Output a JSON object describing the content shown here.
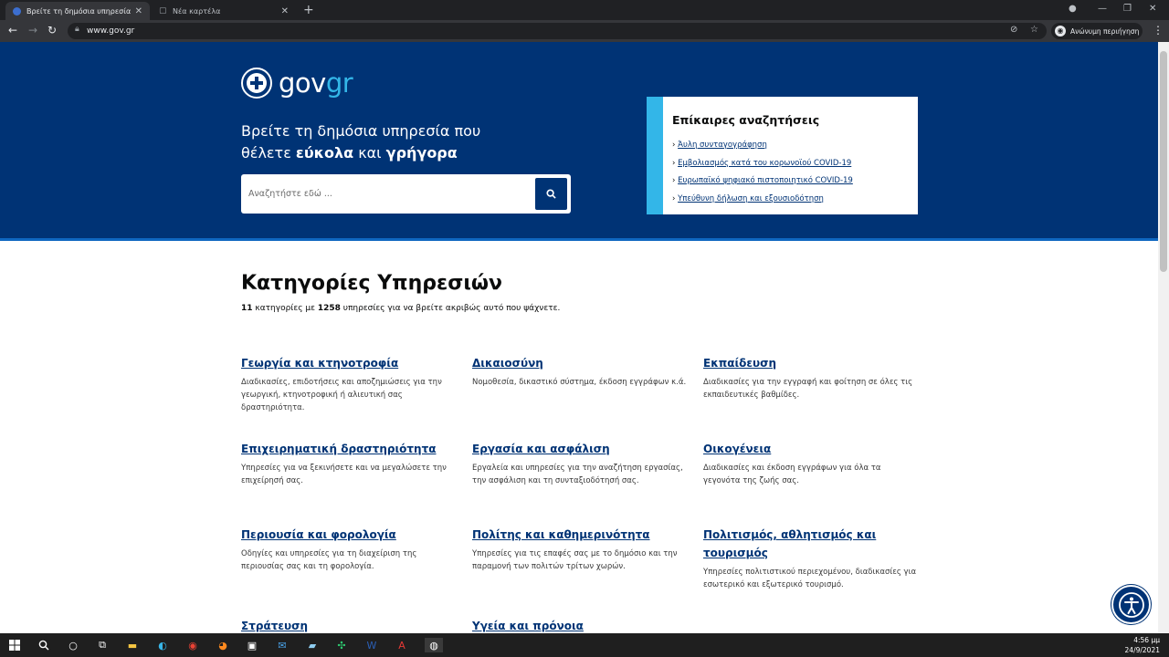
{
  "browser": {
    "tabs": [
      {
        "label": "Βρείτε τη δημόσια υπηρεσία που"
      },
      {
        "label": "Νέα καρτέλα"
      }
    ],
    "url": "www.gov.gr",
    "incognito_label": "Ανώνυμη περιήγηση"
  },
  "hero": {
    "brand_prefix": "gov",
    "brand_suffix": "gr",
    "tagline_line1": "Βρείτε τη δημόσια υπηρεσία που",
    "tagline_pre": "θέλετε ",
    "tagline_bold1": "εύκολα",
    "tagline_mid": " και ",
    "tagline_bold2": "γρήγορα",
    "search_placeholder": "Αναζητήστε εδώ ..."
  },
  "trending": {
    "title": "Επίκαιρες αναζητήσεις",
    "items": [
      "Άυλη συνταγογράφηση",
      "Εμβολιασμός κατά του κορωνοϊού COVID-19",
      "Ευρωπαϊκό ψηφιακό πιστοποιητικό COVID-19",
      "Υπεύθυνη δήλωση και εξουσιοδότηση"
    ]
  },
  "categories_section": {
    "title": "Κατηγορίες Υπηρεσιών",
    "count": "11",
    "text1": " κατηγορίες με ",
    "services": "1258",
    "text2": " υπηρεσίες για να βρείτε ακριβώς αυτό που ψάχνετε."
  },
  "categories": [
    {
      "title": "Γεωργία και κτηνοτροφία",
      "desc": "Διαδικασίες, επιδοτήσεις και αποζημιώσεις για την γεωργική, κτηνοτροφική ή αλιευτική σας δραστηριότητα."
    },
    {
      "title": "Δικαιοσύνη",
      "desc": "Νομοθεσία, δικαστικό σύστημα, έκδοση εγγράφων κ.ά."
    },
    {
      "title": "Εκπαίδευση",
      "desc": "Διαδικασίες για την εγγραφή και φοίτηση σε όλες τις εκπαιδευτικές βαθμίδες."
    },
    {
      "title": "Επιχειρηματική δραστηριότητα",
      "desc": "Υπηρεσίες για να ξεκινήσετε και να μεγαλώσετε την επιχείρησή σας."
    },
    {
      "title": "Εργασία και ασφάλιση",
      "desc": "Εργαλεία και υπηρεσίες για την αναζήτηση εργασίας, την ασφάλιση και τη συνταξιοδότησή σας."
    },
    {
      "title": "Οικογένεια",
      "desc": "Διαδικασίες και έκδοση εγγράφων για όλα τα γεγονότα της ζωής σας."
    },
    {
      "title": "Περιουσία και φορολογία",
      "desc": "Οδηγίες και υπηρεσίες για τη διαχείριση της περιουσίας σας και τη φορολογία."
    },
    {
      "title": "Πολίτης και καθημερινότητα",
      "desc": "Υπηρεσίες για τις επαφές σας με το δημόσιο και την παραμονή των πολιτών τρίτων χωρών."
    },
    {
      "title": "Πολιτισμός, αθλητισμός και τουρισμός",
      "desc": "Υπηρεσίες πολιτιστικού περιεχομένου, διαδικασίες για εσωτερικό και εξωτερικό τουρισμό."
    },
    {
      "title": "Στράτευση",
      "desc": ""
    },
    {
      "title": "Υγεία και πρόνοια",
      "desc": ""
    }
  ],
  "taskbar": {
    "time": "4:56 μμ",
    "date": "24/9/2021"
  }
}
